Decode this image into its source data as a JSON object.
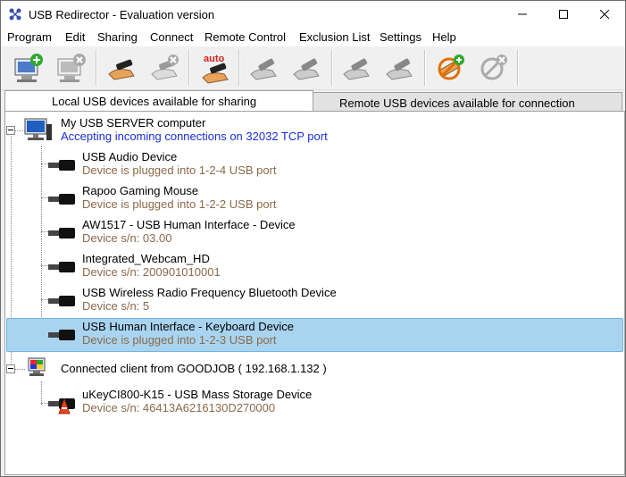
{
  "window": {
    "title": "USB Redirector - Evaluation version",
    "controls": [
      "minimize",
      "maximize",
      "close"
    ]
  },
  "menu": [
    "Program",
    "Edit",
    "Sharing",
    "Connect",
    "Remote Control",
    "Exclusion List",
    "Settings",
    "Help"
  ],
  "toolbar": {
    "auto_label": "auto",
    "buttons": [
      "add-server-icon",
      "remove-server-icon",
      "share-device-icon",
      "unshare-device-icon",
      "auto-share-icon",
      "connect-icon",
      "disconnect-icon",
      "connect-remote-icon",
      "disconnect-remote-icon",
      "add-exclusion-icon",
      "remove-exclusion-icon"
    ]
  },
  "tabs": {
    "local": "Local USB devices available for sharing",
    "remote": "Remote USB devices available for connection"
  },
  "tree": {
    "server": {
      "name": "My USB SERVER computer",
      "status": "Accepting incoming connections on 32032 TCP port"
    },
    "devices": [
      {
        "name": "USB Audio Device",
        "info": "Device is plugged into 1-2-4 USB port"
      },
      {
        "name": "Rapoo Gaming Mouse",
        "info": "Device is plugged into 1-2-2 USB port"
      },
      {
        "name": "AW1517 - USB Human Interface - Device",
        "info": "Device s/n: 03.00"
      },
      {
        "name": "Integrated_Webcam_HD",
        "info": "Device s/n: 200901010001"
      },
      {
        "name": "USB Wireless Radio Frequency Bluetooth Device",
        "info": "Device s/n: 5"
      },
      {
        "name": "USB Human Interface - Keyboard Device",
        "info": "Device is plugged into 1-2-3 USB port"
      }
    ],
    "client": {
      "name": "Connected client from GOODJOB ( 192.168.1.132 )",
      "devices": [
        {
          "name": "uKeyCI800-K15 - USB Mass Storage Device",
          "info": "Device s/n: 46413A6216130D270000"
        }
      ]
    }
  },
  "colors": {
    "selection": "#a9d4f0",
    "info_text": "#8a6a4a",
    "status_blue": "#1a2dd6"
  }
}
